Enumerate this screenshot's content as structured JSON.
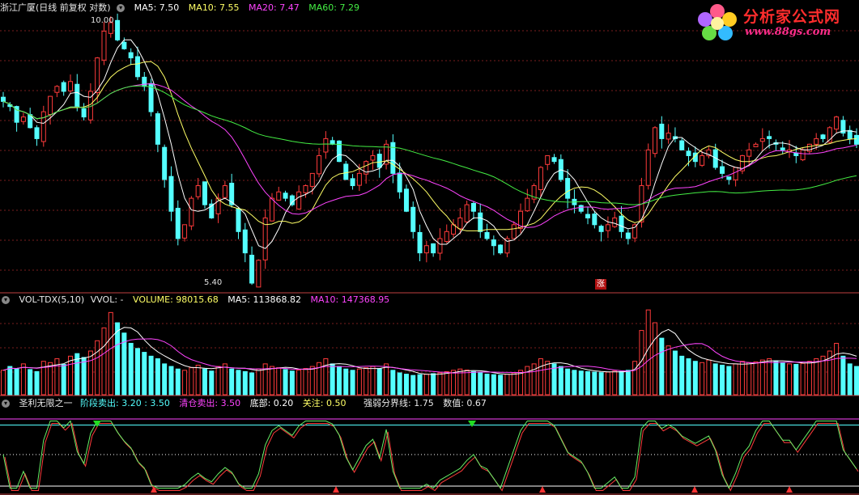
{
  "price_panel": {
    "title": "浙江广厦(日线 前复权 对数)",
    "ma5": "MA5: 7.50",
    "ma10": "MA10: 7.55",
    "ma20": "MA20: 7.47",
    "ma60": "MA60: 7.29",
    "high_label": "10.00",
    "low_label": "5.40",
    "zhang_marker": "涨"
  },
  "volume_panel": {
    "title": "VOL-TDX(5,10)",
    "vvol": "VVOL: -",
    "volume": "VOLUME: 98015.68",
    "ma5": "MA5: 113868.82",
    "ma10": "MA10: 147368.95"
  },
  "indicator_panel": {
    "title": "圣利无限之一",
    "stage_sell": "阶段卖出: 3.20 : 3.50",
    "clear_sell": "清仓卖出: 3.50",
    "bottom": "底部: 0.20",
    "attention": "关注: 0.50",
    "divide": "强弱分界线: 1.75",
    "value": "数值: 0.67"
  },
  "logo": {
    "name": "分析家公式网",
    "url": "www.88gs.com"
  },
  "colors": {
    "up": "#ff3b3b",
    "down": "#54ffff",
    "ma5": "#ffffff",
    "ma10": "#ffff66",
    "ma20": "#ff44ff",
    "ma60": "#44ee44",
    "panel_border": "#c04040"
  },
  "chart_data": [
    {
      "type": "candlestick",
      "title": "浙江广厦(日线 前复权 对数)",
      "scale": "log",
      "annotated_high": 10.0,
      "annotated_low": 5.4,
      "series": [
        {
          "name": "MA5",
          "last": 7.5
        },
        {
          "name": "MA10",
          "last": 7.55
        },
        {
          "name": "MA20",
          "last": 7.47
        },
        {
          "name": "MA60",
          "last": 7.29
        }
      ],
      "close_path": [
        8.3,
        8.2,
        7.9,
        8.0,
        7.8,
        7.6,
        8.1,
        8.4,
        8.6,
        8.5,
        8.7,
        8.2,
        8.0,
        8.5,
        9.2,
        9.8,
        10.0,
        9.6,
        9.4,
        9.2,
        8.8,
        8.6,
        8.1,
        7.5,
        6.9,
        6.4,
        6.0,
        6.2,
        6.6,
        6.8,
        6.5,
        6.3,
        6.6,
        6.8,
        6.5,
        6.1,
        5.8,
        5.4,
        5.7,
        6.3,
        6.6,
        6.7,
        6.6,
        6.5,
        6.7,
        6.8,
        7.0,
        7.3,
        7.6,
        7.5,
        7.2,
        6.9,
        6.8,
        7.0,
        7.2,
        7.3,
        7.1,
        7.5,
        7.0,
        6.7,
        6.4,
        6.1,
        5.8,
        5.9,
        5.8,
        6.0,
        6.1,
        6.2,
        6.3,
        6.5,
        6.4,
        6.1,
        6.0,
        5.9,
        5.8,
        6.0,
        6.2,
        6.4,
        6.6,
        6.8,
        7.1,
        7.3,
        7.2,
        6.9,
        6.6,
        6.5,
        6.4,
        6.3,
        6.2,
        6.1,
        6.2,
        6.3,
        6.1,
        6.0,
        6.2,
        6.8,
        7.4,
        7.8,
        7.6,
        7.7,
        7.6,
        7.4,
        7.3,
        7.2,
        7.3,
        7.4,
        7.1,
        7.0,
        6.9,
        7.1,
        7.3,
        7.4,
        7.5,
        7.6,
        7.6,
        7.5,
        7.4,
        7.4,
        7.3,
        7.4,
        7.5,
        7.6,
        7.6,
        7.8,
        8.0,
        7.7,
        7.6,
        7.5
      ]
    },
    {
      "type": "bar",
      "title": "VOL-TDX(5,10)",
      "series": [
        {
          "name": "VOLUME",
          "last": 98015.68
        },
        {
          "name": "MA5",
          "last": 113868.82
        },
        {
          "name": "MA10",
          "last": 147368.95
        }
      ],
      "volume_path": [
        95,
        110,
        102,
        120,
        98,
        90,
        130,
        125,
        140,
        118,
        150,
        160,
        145,
        170,
        210,
        260,
        320,
        280,
        240,
        200,
        180,
        165,
        150,
        140,
        120,
        110,
        100,
        95,
        105,
        115,
        100,
        92,
        110,
        120,
        100,
        95,
        90,
        85,
        100,
        120,
        110,
        105,
        98,
        92,
        96,
        102,
        110,
        125,
        140,
        120,
        110,
        100,
        95,
        100,
        105,
        110,
        100,
        120,
        95,
        85,
        80,
        75,
        78,
        80,
        82,
        85,
        90,
        95,
        100,
        96,
        90,
        85,
        80,
        78,
        76,
        80,
        85,
        95,
        110,
        120,
        140,
        130,
        120,
        110,
        100,
        95,
        92,
        90,
        88,
        86,
        88,
        92,
        90,
        95,
        130,
        250,
        330,
        280,
        220,
        190,
        170,
        150,
        140,
        130,
        125,
        135,
        120,
        115,
        110,
        120,
        130,
        125,
        128,
        135,
        140,
        132,
        125,
        120,
        118,
        122,
        130,
        140,
        150,
        170,
        200,
        150,
        120,
        110
      ]
    },
    {
      "type": "line",
      "title": "圣利无限之一",
      "levels": {
        "stage_sell": [
          3.2,
          3.5
        ],
        "clear_sell": 3.5,
        "bottom": 0.2,
        "attention": 0.5,
        "divide": 1.75
      },
      "value_last": 0.67
    }
  ]
}
